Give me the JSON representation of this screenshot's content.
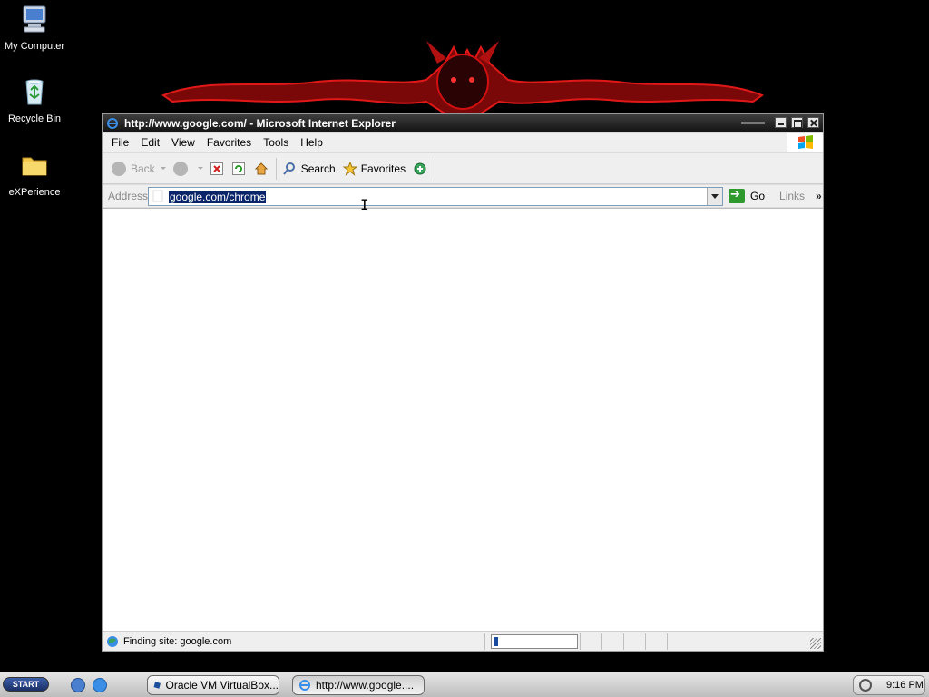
{
  "desktop": {
    "icons": [
      {
        "label": "My Computer",
        "icon": "computer-icon"
      },
      {
        "label": "Recycle Bin",
        "icon": "recycle-bin-icon"
      },
      {
        "label": "eXPerience",
        "icon": "folder-icon"
      }
    ]
  },
  "window": {
    "title": "http://www.google.com/ - Microsoft Internet Explorer",
    "menu": [
      {
        "key": "F",
        "rest": "ile"
      },
      {
        "key": "E",
        "rest": "dit"
      },
      {
        "key": "V",
        "rest": "iew"
      },
      {
        "key": "F",
        "rest": "avorites",
        "prefix": "",
        "mnemonic_index": 1
      },
      {
        "key": "T",
        "rest": "ools"
      },
      {
        "key": "H",
        "rest": "elp"
      }
    ],
    "menu_labels": [
      "File",
      "Edit",
      "View",
      "Favorites",
      "Tools",
      "Help"
    ],
    "toolbar": {
      "back_label": "Back",
      "search_label": "Search",
      "favorites_label": "Favorites"
    },
    "address": {
      "label": "Address",
      "value": "google.com/chrome",
      "go_label": "Go",
      "links_label": "Links",
      "links_chevron": "»"
    },
    "status": {
      "text": "Finding site: google.com",
      "progress": 0.06
    }
  },
  "taskbar": {
    "start_label": "START",
    "tasks": [
      {
        "label": "Oracle VM VirtualBox...",
        "icon": "virtualbox-icon"
      },
      {
        "label": "http://www.google....",
        "icon": "ie-icon"
      }
    ],
    "clock": "9:16 PM"
  },
  "colors": {
    "desktop_bg": "#000000",
    "wallpaper_red": "#c81212",
    "titlebar": "#1e1e1e",
    "selection": "#0a246a",
    "go_green": "#2e9a2e"
  }
}
